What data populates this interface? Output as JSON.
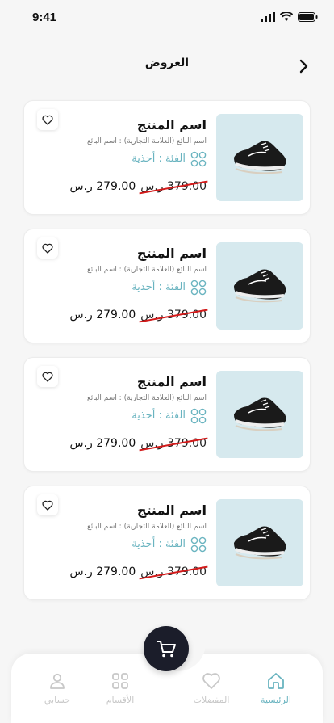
{
  "status": {
    "time": "9:41"
  },
  "header": {
    "title": "العروض"
  },
  "products": [
    {
      "name": "اسم المنتج",
      "seller": "اسم البائع (العلامة التجارية) : اسم البائع",
      "category": "الفئة : أحذية",
      "old_price": "379.00 ر.س",
      "new_price": "279.00 ر.س"
    },
    {
      "name": "اسم المنتج",
      "seller": "اسم البائع (العلامة التجارية) : اسم البائع",
      "category": "الفئة : أحذية",
      "old_price": "379.00 ر.س",
      "new_price": "279.00 ر.س"
    },
    {
      "name": "اسم المنتج",
      "seller": "اسم البائع (العلامة التجارية) : اسم البائع",
      "category": "الفئة : أحذية",
      "old_price": "379.00 ر.س",
      "new_price": "279.00 ر.س"
    },
    {
      "name": "اسم المنتج",
      "seller": "اسم البائع (العلامة التجارية) : اسم البائع",
      "category": "الفئة : أحذية",
      "old_price": "379.00 ر.س",
      "new_price": "279.00 ر.س"
    }
  ],
  "nav": {
    "home": "الرئيسية",
    "favorites": "المفضلات",
    "categories": "الأقسام",
    "account": "حسابي"
  },
  "colors": {
    "accent": "#6ab4c0",
    "cart": "#1b1d2a",
    "strike": "#d21a1a"
  }
}
